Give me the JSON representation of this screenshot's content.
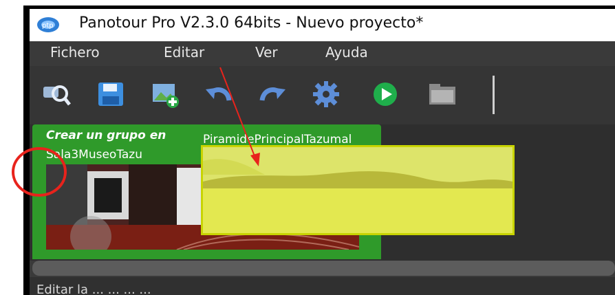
{
  "window": {
    "title": "Panotour Pro V2.3.0 64bits - Nuevo proyecto*"
  },
  "menu": {
    "items": [
      {
        "label": "Fichero"
      },
      {
        "label": "Editar"
      },
      {
        "label": "Ver"
      },
      {
        "label": "Ayuda"
      }
    ]
  },
  "toolbar": {
    "buttons": [
      {
        "icon": "zoom-search-icon"
      },
      {
        "icon": "save-icon"
      },
      {
        "icon": "add-image-icon"
      },
      {
        "icon": "undo-icon"
      },
      {
        "icon": "redo-icon"
      },
      {
        "icon": "settings-gear-icon"
      },
      {
        "icon": "play-icon"
      },
      {
        "icon": "folder-icon"
      }
    ]
  },
  "content": {
    "group_title": "Crear un grupo en",
    "panorama_label": "Sala3MuseoTazu",
    "dragged_label": "PiramidePrincipalTazumal"
  },
  "statusbar": {
    "text": "Editar la ... ... ... ..."
  },
  "annotations": {
    "arrow_color": "#e8231c",
    "circle_color": "#e8231c"
  }
}
